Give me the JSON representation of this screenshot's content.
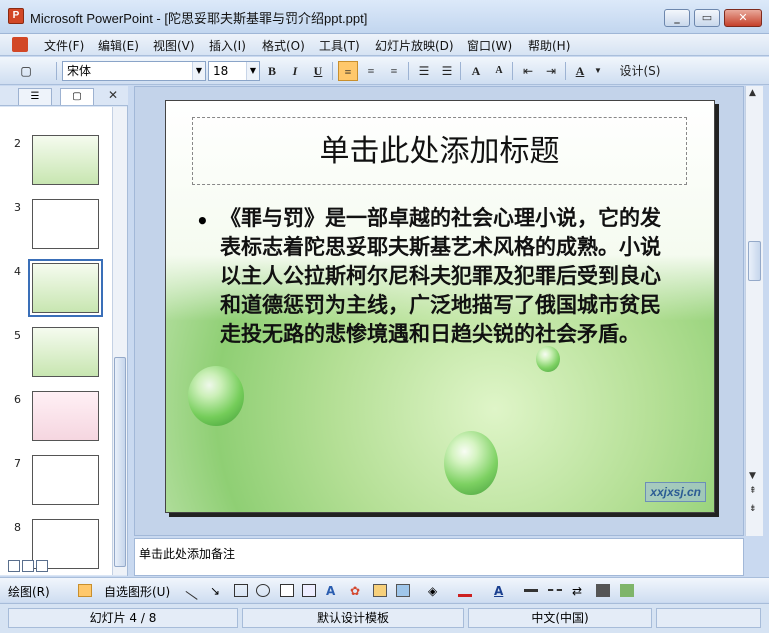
{
  "window": {
    "title": "Microsoft PowerPoint - [陀思妥耶夫斯基罪与罚介绍ppt.ppt]",
    "app_icon": "P",
    "controls": {
      "minimize": "_",
      "restore": "▭",
      "close": "✕"
    }
  },
  "menubar": {
    "items": [
      "文件(F)",
      "编辑(E)",
      "视图(V)",
      "插入(I)",
      "格式(O)",
      "工具(T)",
      "幻灯片放映(D)",
      "窗口(W)",
      "帮助(H)"
    ]
  },
  "toolbar": {
    "font_name": "宋体",
    "font_size": "18",
    "bold": "B",
    "italic": "I",
    "underline": "U",
    "font_color_label": "A",
    "design_label": "设计(S)"
  },
  "left_panel": {
    "tab_outline": "☰",
    "tab_slides": "▢",
    "close": "✕",
    "slides": [
      {
        "number": "2"
      },
      {
        "number": "3"
      },
      {
        "number": "4",
        "selected": true
      },
      {
        "number": "5"
      },
      {
        "number": "6"
      },
      {
        "number": "7"
      },
      {
        "number": "8"
      }
    ]
  },
  "slide": {
    "title_placeholder": "单击此处添加标题",
    "bullet": "•",
    "body_text": "《罪与罚》是一部卓越的社会心理小说，它的发表标志着陀思妥耶夫斯基艺术风格的成熟。小说以主人公拉斯柯尔尼科夫犯罪及犯罪后受到良心和道德惩罚为主线，广泛地描写了俄国城市贫民走投无路的悲惨境遇和日趋尖锐的社会矛盾。",
    "watermark": "xxjxsj.cn"
  },
  "notes": {
    "placeholder": "单击此处添加备注"
  },
  "drawbar": {
    "draw_label": "绘图(R)",
    "autoshape_label": "自选图形(U)"
  },
  "statusbar": {
    "slide_info": "幻灯片 4 / 8",
    "template": "默认设计模板",
    "language": "中文(中国)"
  }
}
